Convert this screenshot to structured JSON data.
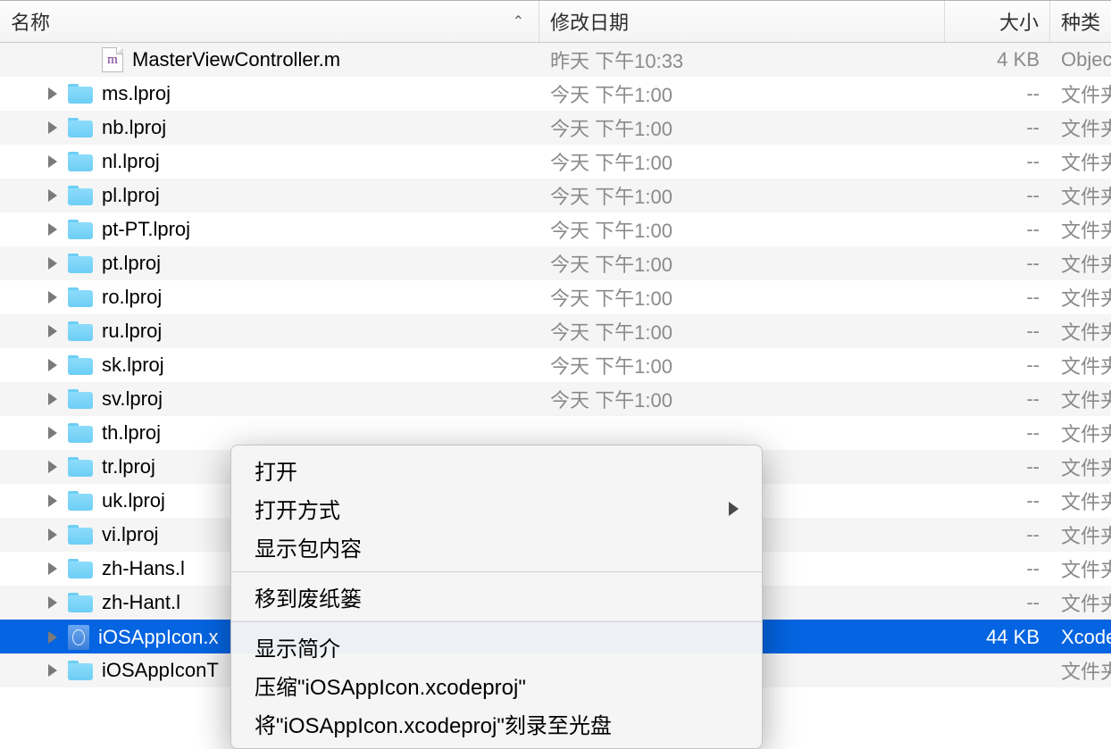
{
  "columns": {
    "name": "名称",
    "date": "修改日期",
    "size": "大小",
    "kind": "种类"
  },
  "rows": [
    {
      "type": "file-m",
      "indent": 1,
      "disclosure": false,
      "name": "MasterViewController.m",
      "date": "昨天 下午10:33",
      "size": "4 KB",
      "kind": "Objec"
    },
    {
      "type": "folder",
      "indent": 0,
      "disclosure": true,
      "name": "ms.lproj",
      "date": "今天 下午1:00",
      "size": "--",
      "kind": "文件夹"
    },
    {
      "type": "folder",
      "indent": 0,
      "disclosure": true,
      "name": "nb.lproj",
      "date": "今天 下午1:00",
      "size": "--",
      "kind": "文件夹"
    },
    {
      "type": "folder",
      "indent": 0,
      "disclosure": true,
      "name": "nl.lproj",
      "date": "今天 下午1:00",
      "size": "--",
      "kind": "文件夹"
    },
    {
      "type": "folder",
      "indent": 0,
      "disclosure": true,
      "name": "pl.lproj",
      "date": "今天 下午1:00",
      "size": "--",
      "kind": "文件夹"
    },
    {
      "type": "folder",
      "indent": 0,
      "disclosure": true,
      "name": "pt-PT.lproj",
      "date": "今天 下午1:00",
      "size": "--",
      "kind": "文件夹"
    },
    {
      "type": "folder",
      "indent": 0,
      "disclosure": true,
      "name": "pt.lproj",
      "date": "今天 下午1:00",
      "size": "--",
      "kind": "文件夹"
    },
    {
      "type": "folder",
      "indent": 0,
      "disclosure": true,
      "name": "ro.lproj",
      "date": "今天 下午1:00",
      "size": "--",
      "kind": "文件夹"
    },
    {
      "type": "folder",
      "indent": 0,
      "disclosure": true,
      "name": "ru.lproj",
      "date": "今天 下午1:00",
      "size": "--",
      "kind": "文件夹"
    },
    {
      "type": "folder",
      "indent": 0,
      "disclosure": true,
      "name": "sk.lproj",
      "date": "今天 下午1:00",
      "size": "--",
      "kind": "文件夹"
    },
    {
      "type": "folder",
      "indent": 0,
      "disclosure": true,
      "name": "sv.lproj",
      "date": "今天 下午1:00",
      "size": "--",
      "kind": "文件夹"
    },
    {
      "type": "folder",
      "indent": 0,
      "disclosure": true,
      "name": "th.lproj",
      "date": "",
      "size": "--",
      "kind": "文件夹"
    },
    {
      "type": "folder",
      "indent": 0,
      "disclosure": true,
      "name": "tr.lproj",
      "date": "",
      "size": "--",
      "kind": "文件夹"
    },
    {
      "type": "folder",
      "indent": 0,
      "disclosure": true,
      "name": "uk.lproj",
      "date": "",
      "size": "--",
      "kind": "文件夹"
    },
    {
      "type": "folder",
      "indent": 0,
      "disclosure": true,
      "name": "vi.lproj",
      "date": "",
      "size": "--",
      "kind": "文件夹"
    },
    {
      "type": "folder",
      "indent": 0,
      "disclosure": true,
      "name": "zh-Hans.l",
      "date": "",
      "size": "--",
      "kind": "文件夹"
    },
    {
      "type": "folder",
      "indent": 0,
      "disclosure": true,
      "name": "zh-Hant.l",
      "date": "",
      "size": "--",
      "kind": "文件夹"
    },
    {
      "type": "xcode",
      "indent": 0,
      "disclosure": true,
      "name": "iOSAppIcon.x",
      "date": "",
      "size": "44 KB",
      "kind": "Xcode",
      "selected": true
    },
    {
      "type": "folder",
      "indent": 0,
      "disclosure": true,
      "name": "iOSAppIconT",
      "date": "",
      "size": "",
      "kind": "文件夹"
    }
  ],
  "menu": {
    "open": "打开",
    "openWith": "打开方式",
    "showPackageContents": "显示包内容",
    "moveToTrash": "移到废纸篓",
    "getInfo": "显示简介",
    "compress": "压缩\"iOSAppIcon.xcodeproj\"",
    "burn": "将\"iOSAppIcon.xcodeproj\"刻录至光盘"
  }
}
